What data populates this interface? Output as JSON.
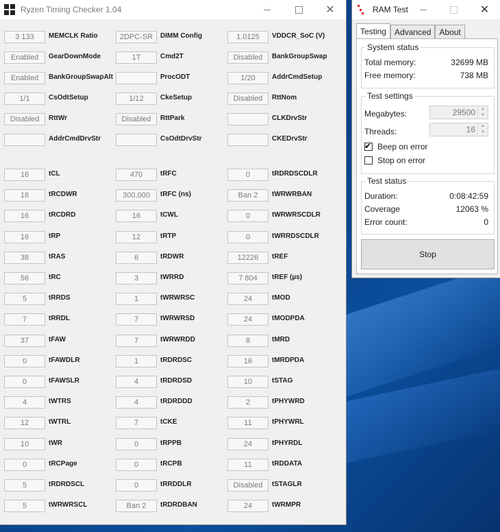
{
  "desktop": {},
  "ryzen_window": {
    "title": "Ryzen Timing Checker 1.04",
    "top_rows": [
      [
        {
          "value": "3 133",
          "label": "MEMCLK Ratio"
        },
        {
          "value": "2DPC-SR",
          "label": "DIMM Config"
        },
        {
          "value": "1.0125",
          "label": "VDDCR_SoC (V)"
        }
      ],
      [
        {
          "value": "Enabled",
          "label": "GearDownMode"
        },
        {
          "value": "1T",
          "label": "Cmd2T"
        },
        {
          "value": "Disabled",
          "label": "BankGroupSwap"
        }
      ],
      [
        {
          "value": "Enabled",
          "label": "BankGroupSwapAlt"
        },
        {
          "value": "",
          "label": "ProcODT"
        },
        {
          "value": "1/20",
          "label": "AddrCmdSetup"
        }
      ],
      [
        {
          "value": "1/1",
          "label": "CsOdtSetup"
        },
        {
          "value": "1/12",
          "label": "CkeSetup"
        },
        {
          "value": "Disabled",
          "label": "RttNom"
        }
      ],
      [
        {
          "value": "Disabled",
          "label": "RttWr"
        },
        {
          "value": "Disabled",
          "label": "RttPark"
        },
        {
          "value": "",
          "label": "CLKDrvStr"
        }
      ],
      [
        {
          "value": "",
          "label": "AddrCmdDrvStr"
        },
        {
          "value": "",
          "label": "CsOdtDrvStr"
        },
        {
          "value": "",
          "label": "CKEDrvStr"
        }
      ]
    ],
    "timing_rows": [
      [
        {
          "value": "16",
          "label": "tCL"
        },
        {
          "value": "470",
          "label": "tRFC"
        },
        {
          "value": "0",
          "label": "tRDRDSCDLR"
        }
      ],
      [
        {
          "value": "16",
          "label": "tRCDWR"
        },
        {
          "value": "300,000",
          "label": "tRFC (ns)"
        },
        {
          "value": "Ban 2",
          "label": "tWRWRBAN"
        }
      ],
      [
        {
          "value": "16",
          "label": "tRCDRD"
        },
        {
          "value": "16",
          "label": "tCWL"
        },
        {
          "value": "0",
          "label": "tWRWRSCDLR"
        }
      ],
      [
        {
          "value": "16",
          "label": "tRP"
        },
        {
          "value": "12",
          "label": "tRTP"
        },
        {
          "value": "0",
          "label": "tWRRDSCDLR"
        }
      ],
      [
        {
          "value": "38",
          "label": "tRAS"
        },
        {
          "value": "6",
          "label": "tRDWR"
        },
        {
          "value": "12226",
          "label": "tREF"
        }
      ],
      [
        {
          "value": "56",
          "label": "tRC"
        },
        {
          "value": "3",
          "label": "tWRRD"
        },
        {
          "value": "7 804",
          "label": "tREF (µs)"
        }
      ],
      [
        {
          "value": "5",
          "label": "tRRDS"
        },
        {
          "value": "1",
          "label": "tWRWRSC"
        },
        {
          "value": "24",
          "label": "tMOD"
        }
      ],
      [
        {
          "value": "7",
          "label": "tRRDL"
        },
        {
          "value": "7",
          "label": "tWRWRSD"
        },
        {
          "value": "24",
          "label": "tMODPDA"
        }
      ],
      [
        {
          "value": "37",
          "label": "tFAW"
        },
        {
          "value": "7",
          "label": "tWRWRDD"
        },
        {
          "value": "8",
          "label": "tMRD"
        }
      ],
      [
        {
          "value": "0",
          "label": "tFAWDLR"
        },
        {
          "value": "1",
          "label": "tRDRDSC"
        },
        {
          "value": "16",
          "label": "tMRDPDA"
        }
      ],
      [
        {
          "value": "0",
          "label": "tFAWSLR"
        },
        {
          "value": "4",
          "label": "tRDRDSD"
        },
        {
          "value": "10",
          "label": "tSTAG"
        }
      ],
      [
        {
          "value": "4",
          "label": "tWTRS"
        },
        {
          "value": "4",
          "label": "tRDRDDD"
        },
        {
          "value": "2",
          "label": "tPHYWRD"
        }
      ],
      [
        {
          "value": "12",
          "label": "tWTRL"
        },
        {
          "value": "7",
          "label": "tCKE"
        },
        {
          "value": "11",
          "label": "tPHYWRL"
        }
      ],
      [
        {
          "value": "10",
          "label": "tWR"
        },
        {
          "value": "0",
          "label": "tRPPB"
        },
        {
          "value": "24",
          "label": "tPHYRDL"
        }
      ],
      [
        {
          "value": "0",
          "label": "tRCPage"
        },
        {
          "value": "0",
          "label": "tRCPB"
        },
        {
          "value": "11",
          "label": "tRDDATA"
        }
      ],
      [
        {
          "value": "5",
          "label": "tRDRDSCL"
        },
        {
          "value": "0",
          "label": "tRRDDLR"
        },
        {
          "value": "Disabled",
          "label": "tSTAGLR"
        }
      ],
      [
        {
          "value": "5",
          "label": "tWRWRSCL"
        },
        {
          "value": "Ban 2",
          "label": "tRDRDBAN"
        },
        {
          "value": "24",
          "label": "tWRMPR"
        }
      ]
    ]
  },
  "ram_window": {
    "title": "RAM Test",
    "tabs": [
      {
        "label": "Testing",
        "active": true
      },
      {
        "label": "Advanced",
        "active": false
      },
      {
        "label": "About",
        "active": false
      }
    ],
    "system_status": {
      "title": "System status",
      "total_label": "Total memory:",
      "total_value": "32699 MB",
      "free_label": "Free memory:",
      "free_value": "738 MB"
    },
    "test_settings": {
      "title": "Test settings",
      "megabytes_label": "Megabytes:",
      "megabytes_value": "29500",
      "threads_label": "Threads:",
      "threads_value": "16",
      "beep_label": "Beep on error",
      "beep_checked": true,
      "stop_label": "Stop on error",
      "stop_checked": false
    },
    "test_status": {
      "title": "Test status",
      "duration_label": "Duration:",
      "duration_value": "0:08:42:59",
      "coverage_label": "Coverage",
      "coverage_value": "12063 %",
      "errors_label": "Error count:",
      "errors_value": "0"
    },
    "stop_button": "Stop"
  }
}
